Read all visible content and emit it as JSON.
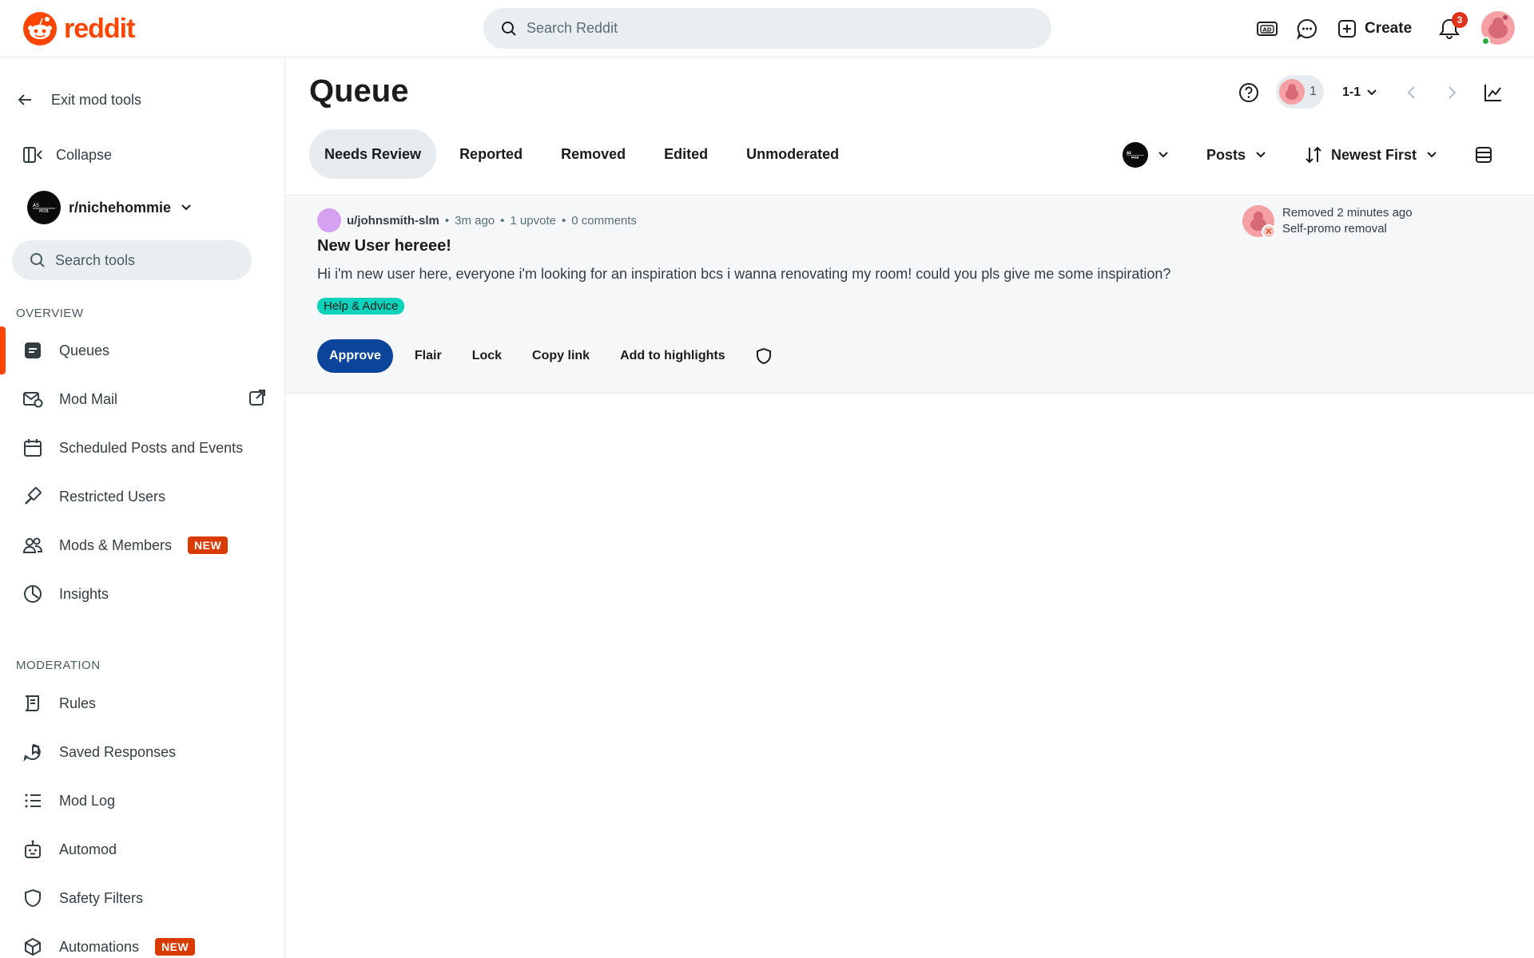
{
  "brand": {
    "name": "reddit",
    "color": "#ff4500"
  },
  "header": {
    "search_placeholder": "Search Reddit",
    "create_label": "Create",
    "notification_count": "3"
  },
  "sidebar": {
    "exit_label": "Exit mod tools",
    "collapse_label": "Collapse",
    "subreddit": "r/nichehommie",
    "search_tools_placeholder": "Search tools",
    "overview_title": "OVERVIEW",
    "moderation_title": "MODERATION",
    "new_badge": "NEW",
    "overview_items": [
      {
        "label": "Queues",
        "icon": "queue-icon",
        "active": true
      },
      {
        "label": "Mod Mail",
        "icon": "mod-mail-icon"
      },
      {
        "label": "Scheduled Posts and Events",
        "icon": "calendar-icon"
      },
      {
        "label": "Restricted Users",
        "icon": "gavel-icon"
      },
      {
        "label": "Mods & Members",
        "icon": "members-icon",
        "badge": "NEW"
      },
      {
        "label": "Insights",
        "icon": "pie-chart-icon"
      }
    ],
    "moderation_items": [
      {
        "label": "Rules",
        "icon": "rules-scroll-icon"
      },
      {
        "label": "Saved Responses",
        "icon": "saved-responses-icon"
      },
      {
        "label": "Mod Log",
        "icon": "list-icon"
      },
      {
        "label": "Automod",
        "icon": "robot-icon"
      },
      {
        "label": "Safety Filters",
        "icon": "shield-icon"
      },
      {
        "label": "Automations",
        "icon": "cube-icon",
        "badge": "NEW"
      }
    ]
  },
  "main": {
    "title": "Queue",
    "mod_count": "1",
    "range": "1-1",
    "tabs": [
      {
        "label": "Needs Review",
        "active": true
      },
      {
        "label": "Reported"
      },
      {
        "label": "Removed"
      },
      {
        "label": "Edited"
      },
      {
        "label": "Unmoderated"
      }
    ],
    "filter_type": "Posts",
    "sort": "Newest First"
  },
  "post": {
    "author": "u/johnsmith-slm",
    "time": "3m ago",
    "upvotes": "1 upvote",
    "comments": "0 comments",
    "separator": "•",
    "title": "New User hereee!",
    "body": "Hi i'm new user here, everyone i'm looking for an inspiration bcs i wanna renovating my room! could you pls give me some inspiration?",
    "flair": "Help & Advice",
    "removed_status": "Removed 2 minutes ago",
    "removed_reason": "Self-promo removal",
    "actions": {
      "approve": "Approve",
      "flair": "Flair",
      "lock": "Lock",
      "copy_link": "Copy link",
      "highlights": "Add to highlights"
    }
  }
}
